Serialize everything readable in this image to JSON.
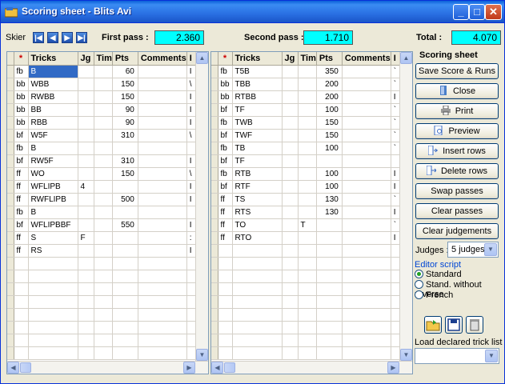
{
  "window": {
    "title": "Scoring sheet - Blits Avi"
  },
  "topbar": {
    "skier_label": "Skier",
    "first_pass_label": "First pass :",
    "first_pass_value": "2.360",
    "second_pass_label": "Second pass :",
    "second_pass_value": "1.710",
    "total_label": "Total :",
    "total_value": "4.070"
  },
  "columns": [
    "*",
    "Tricks",
    "Jg",
    "Tim",
    "Pts",
    "Comments",
    "I"
  ],
  "pass1": [
    [
      "fb",
      "B",
      "",
      "",
      "60",
      "",
      "I"
    ],
    [
      "bb",
      "WBB",
      "",
      "",
      "150",
      "",
      "\\"
    ],
    [
      "bb",
      "RWBB",
      "",
      "",
      "150",
      "",
      "I"
    ],
    [
      "bb",
      "BB",
      "",
      "",
      "90",
      "",
      "I"
    ],
    [
      "bb",
      "RBB",
      "",
      "",
      "90",
      "",
      "I"
    ],
    [
      "bf",
      "W5F",
      "",
      "",
      "310",
      "",
      "\\"
    ],
    [
      "fb",
      "B",
      "",
      "",
      "",
      "",
      ""
    ],
    [
      "bf",
      "RW5F",
      "",
      "",
      "310",
      "",
      "I"
    ],
    [
      "ff",
      "WO",
      "",
      "",
      "150",
      "",
      "\\"
    ],
    [
      "ff",
      "WFLIPB",
      "4",
      "",
      "",
      "",
      "I"
    ],
    [
      "ff",
      "RWFLIPB",
      "",
      "",
      "500",
      "",
      "I"
    ],
    [
      "fb",
      "B",
      "",
      "",
      "",
      "",
      ""
    ],
    [
      "bf",
      "WFLIPBBF",
      "",
      "",
      "550",
      "",
      "I"
    ],
    [
      "ff",
      "S",
      "F",
      "",
      "",
      "",
      ":"
    ],
    [
      "ff",
      "RS",
      "",
      "",
      "",
      "",
      "I"
    ]
  ],
  "pass2": [
    [
      "fb",
      "T5B",
      "",
      "",
      "350",
      "",
      "`"
    ],
    [
      "bb",
      "TBB",
      "",
      "",
      "200",
      "",
      "`"
    ],
    [
      "bb",
      "RTBB",
      "",
      "",
      "200",
      "",
      "I"
    ],
    [
      "bf",
      "TF",
      "",
      "",
      "100",
      "",
      "`"
    ],
    [
      "fb",
      "TWB",
      "",
      "",
      "150",
      "",
      "`"
    ],
    [
      "bf",
      "TWF",
      "",
      "",
      "150",
      "",
      "`"
    ],
    [
      "fb",
      "TB",
      "",
      "",
      "100",
      "",
      "`"
    ],
    [
      "bf",
      "TF",
      "",
      "",
      "",
      "",
      ""
    ],
    [
      "fb",
      "RTB",
      "",
      "",
      "100",
      "",
      "I"
    ],
    [
      "bf",
      "RTF",
      "",
      "",
      "100",
      "",
      "I"
    ],
    [
      "ff",
      "TS",
      "",
      "",
      "130",
      "",
      "`"
    ],
    [
      "ff",
      "RTS",
      "",
      "",
      "130",
      "",
      "I"
    ],
    [
      "ff",
      "TO",
      "",
      "T",
      "",
      "",
      "`"
    ],
    [
      "ff",
      "RTO",
      "",
      "",
      "",
      "",
      "I"
    ]
  ],
  "side": {
    "title": "Scoring sheet",
    "save": "Save Score & Runs",
    "close": "Close",
    "print": "Print",
    "preview": "Preview",
    "insert": "Insert rows",
    "delete": "Delete rows",
    "swap": "Swap passes",
    "clear": "Clear passes",
    "clear_judgements": "Clear judgements",
    "judges_label": "Judges :",
    "judges_value": "5 judges",
    "editor_label": "Editor script",
    "radio_standard": "Standard",
    "radio_noreverse": "Stand. without reverse",
    "radio_french": "French",
    "load_label": "Load declared trick list :",
    "load_value": ""
  }
}
